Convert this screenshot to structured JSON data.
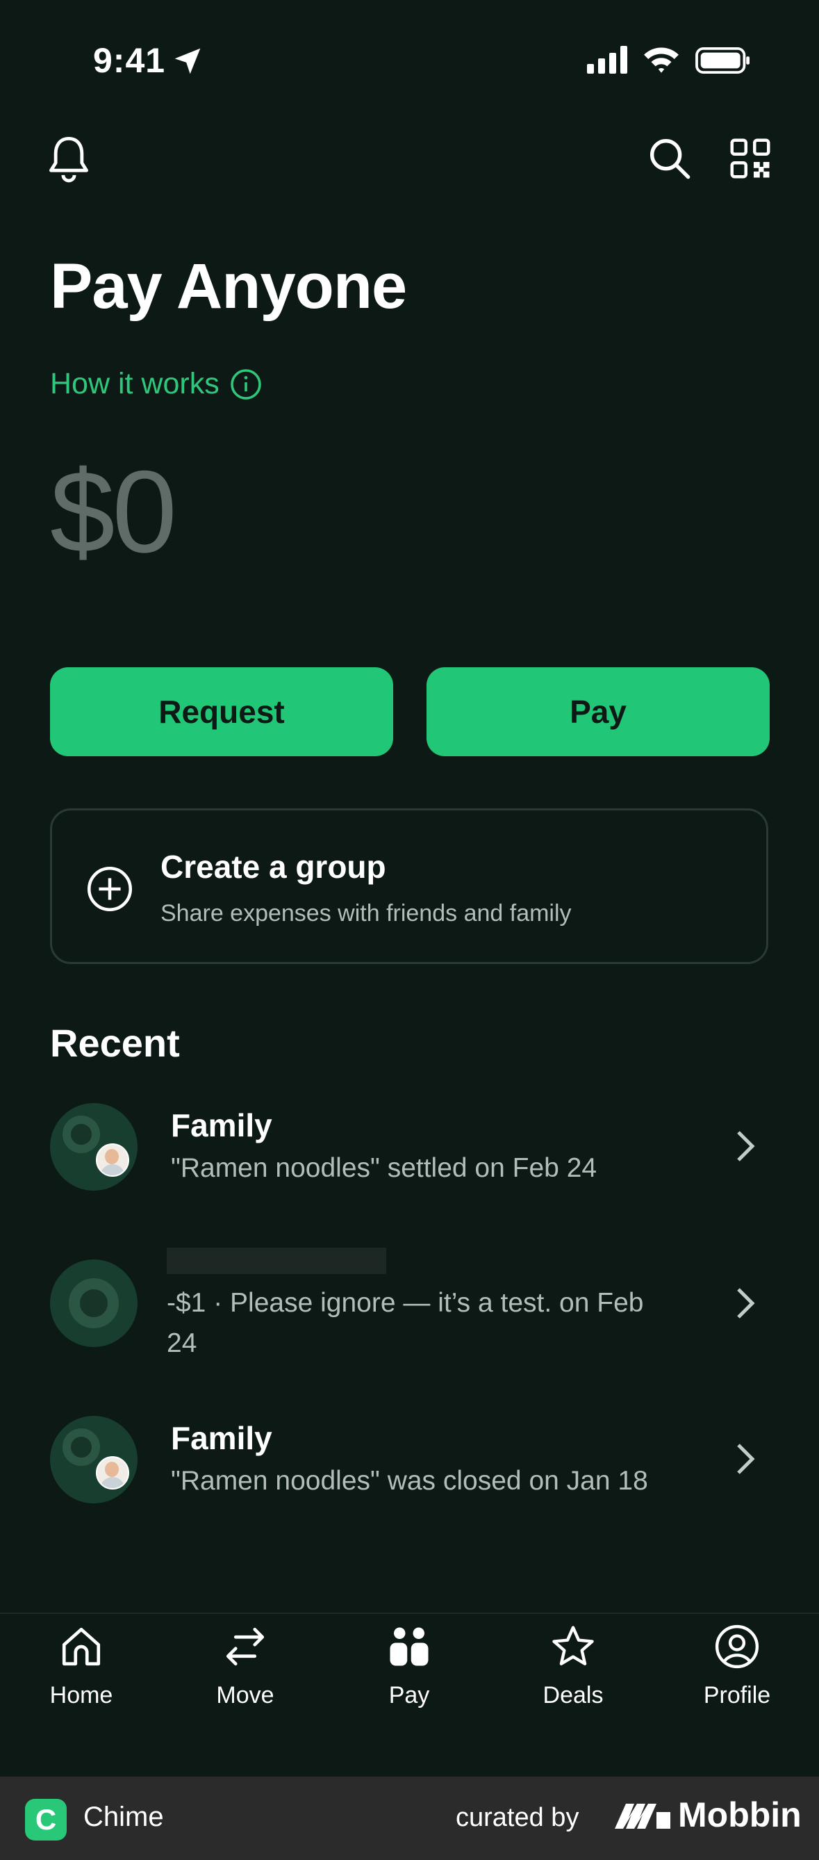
{
  "status_bar": {
    "time": "9:41"
  },
  "header": {
    "title": "Pay Anyone",
    "how_it_works": "How it works"
  },
  "amount": "$0",
  "actions": {
    "request_label": "Request",
    "pay_label": "Pay"
  },
  "group_card": {
    "title": "Create a group",
    "subtitle": "Share expenses with friends and family"
  },
  "recent": {
    "heading": "Recent",
    "items": [
      {
        "title": "Family",
        "subtitle": "\"Ramen noodles\" settled on Feb 24"
      },
      {
        "title": "",
        "subtitle_line1": "-$1 · Please ignore — it’s a test. on Feb",
        "subtitle_line2": "24"
      },
      {
        "title": "Family",
        "subtitle": "\"Ramen noodles\" was closed on Jan 18"
      }
    ]
  },
  "tabs": [
    {
      "label": "Home",
      "icon": "home-icon"
    },
    {
      "label": "Move",
      "icon": "arrows-icon"
    },
    {
      "label": "Pay",
      "icon": "people-icon",
      "active": true
    },
    {
      "label": "Deals",
      "icon": "star-icon"
    },
    {
      "label": "Profile",
      "icon": "profile-icon"
    }
  ],
  "footer": {
    "app_name": "Chime",
    "curated_by": "curated by",
    "brand": "Mobbin"
  },
  "colors": {
    "background": "#0c1915",
    "accent": "#21c777",
    "link": "#2fc77c"
  }
}
